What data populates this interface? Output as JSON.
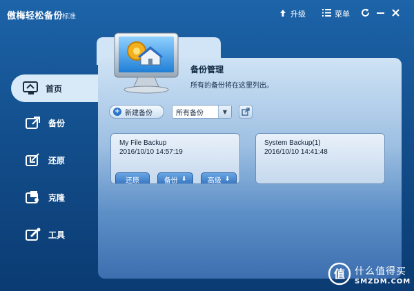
{
  "window": {
    "title": "傲梅轻松备份",
    "edition": "标准",
    "upgrade_label": "升级",
    "menu_label": "菜单"
  },
  "sidebar": {
    "items": [
      {
        "label": "首页",
        "icon": "home-monitor-icon",
        "active": true
      },
      {
        "label": "备份",
        "icon": "backup-icon",
        "active": false
      },
      {
        "label": "还原",
        "icon": "restore-icon",
        "active": false
      },
      {
        "label": "克隆",
        "icon": "clone-icon",
        "active": false
      },
      {
        "label": "工具",
        "icon": "tools-icon",
        "active": false
      }
    ]
  },
  "main": {
    "title": "备份管理",
    "subtitle": "所有的备份将在这里列出。",
    "new_backup_label": "新建备份",
    "filter_selected": "所有备份"
  },
  "backups": [
    {
      "name": "My File Backup",
      "time": "2016/10/10 14:57:19",
      "actions": {
        "restore": "还原",
        "backup": "备份",
        "advanced": "高级"
      }
    },
    {
      "name": "System Backup(1)",
      "time": "2016/10/10 14:41:48"
    }
  ],
  "watermark": {
    "glyph": "值",
    "line1": "什么值得买",
    "line2": "SMZDM.COM"
  },
  "colors": {
    "background": "#134f8d",
    "panel_light": "#cfe3f5",
    "accent_blue": "#2f6fc0"
  }
}
